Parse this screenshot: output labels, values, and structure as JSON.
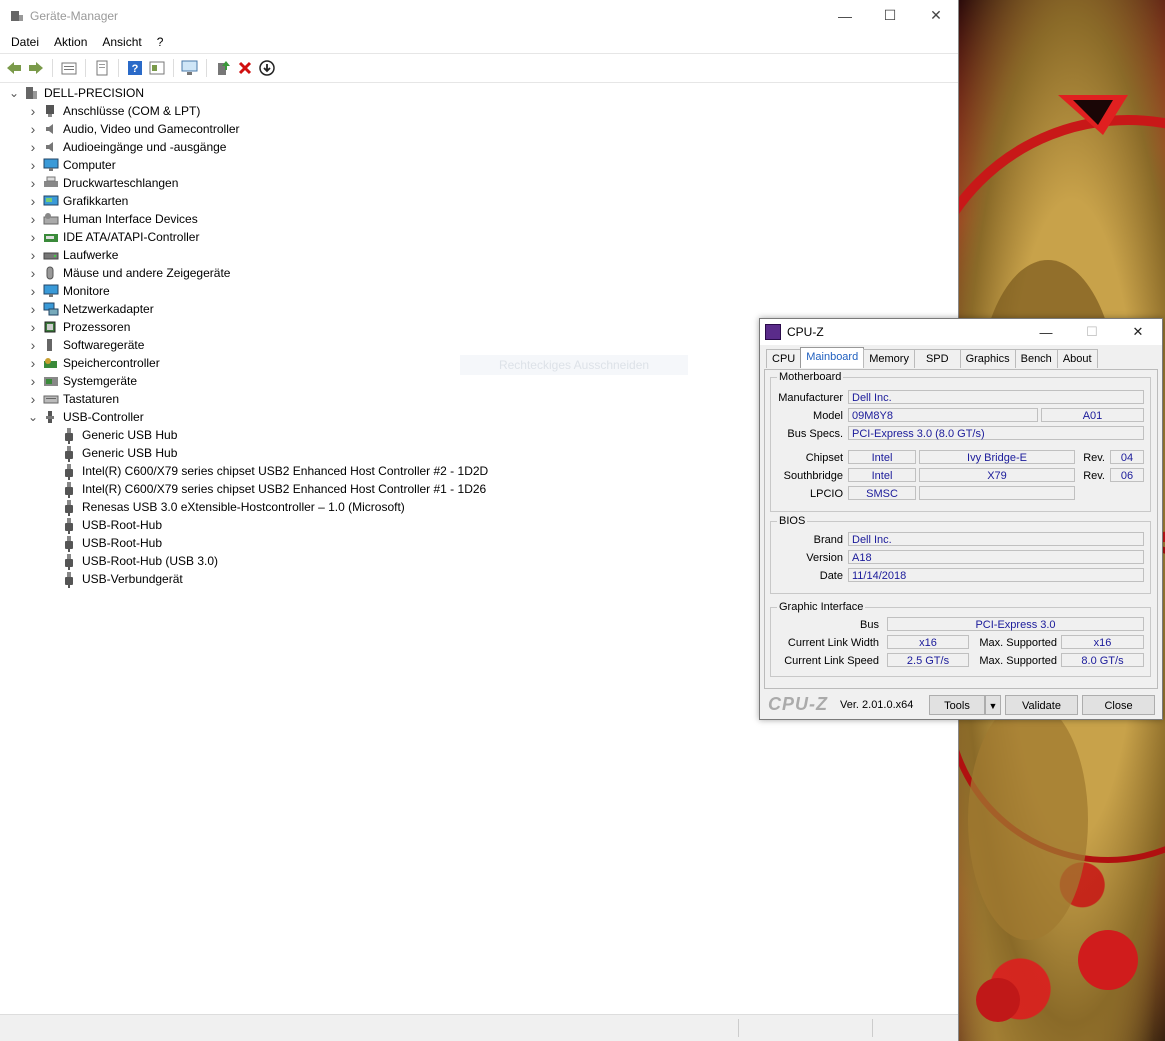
{
  "device_manager": {
    "title": "Geräte-Manager",
    "menu": [
      "Datei",
      "Aktion",
      "Ansicht",
      "?"
    ],
    "root": "DELL-PRECISION",
    "categories": [
      {
        "label": "Anschlüsse (COM & LPT)",
        "icon": "port-icon"
      },
      {
        "label": "Audio, Video und Gamecontroller",
        "icon": "speaker-icon"
      },
      {
        "label": "Audioeingänge und -ausgänge",
        "icon": "speaker-icon"
      },
      {
        "label": "Computer",
        "icon": "monitor-icon"
      },
      {
        "label": "Druckwarteschlangen",
        "icon": "printer-icon"
      },
      {
        "label": "Grafikkarten",
        "icon": "display-adapter-icon"
      },
      {
        "label": "Human Interface Devices",
        "icon": "hid-icon"
      },
      {
        "label": "IDE ATA/ATAPI-Controller",
        "icon": "ide-controller-icon"
      },
      {
        "label": "Laufwerke",
        "icon": "disk-drive-icon"
      },
      {
        "label": "Mäuse und andere Zeigegeräte",
        "icon": "mouse-icon"
      },
      {
        "label": "Monitore",
        "icon": "monitor-icon"
      },
      {
        "label": "Netzwerkadapter",
        "icon": "network-adapter-icon"
      },
      {
        "label": "Prozessoren",
        "icon": "processor-icon"
      },
      {
        "label": "Softwaregeräte",
        "icon": "software-device-icon"
      },
      {
        "label": "Speichercontroller",
        "icon": "storage-controller-icon"
      },
      {
        "label": "Systemgeräte",
        "icon": "system-device-icon"
      },
      {
        "label": "Tastaturen",
        "icon": "keyboard-icon"
      }
    ],
    "usb_category": "USB-Controller",
    "usb_devices": [
      "Generic USB Hub",
      "Generic USB Hub",
      "Intel(R) C600/X79 series chipset USB2 Enhanced Host Controller #2 - 1D2D",
      "Intel(R) C600/X79 series chipset USB2 Enhanced Host Controller #1 - 1D26",
      "Renesas USB 3.0 eXtensible-Hostcontroller – 1.0 (Microsoft)",
      "USB-Root-Hub",
      "USB-Root-Hub",
      "USB-Root-Hub (USB 3.0)",
      "USB-Verbundgerät"
    ],
    "ghost_tooltip": "Rechteckiges Ausschneiden"
  },
  "cpuz": {
    "title": "CPU-Z",
    "tabs": [
      "CPU",
      "Mainboard",
      "Memory",
      "SPD",
      "Graphics",
      "Bench",
      "About"
    ],
    "active_tab": "Mainboard",
    "motherboard": {
      "group": "Motherboard",
      "manufacturer_label": "Manufacturer",
      "manufacturer": "Dell Inc.",
      "model_label": "Model",
      "model": "09M8Y8",
      "model_rev": "A01",
      "busspecs_label": "Bus Specs.",
      "busspecs": "PCI-Express 3.0 (8.0 GT/s)",
      "chipset_label": "Chipset",
      "chipset_vendor": "Intel",
      "chipset_name": "Ivy Bridge-E",
      "chipset_rev_label": "Rev.",
      "chipset_rev": "04",
      "southbridge_label": "Southbridge",
      "southbridge_vendor": "Intel",
      "southbridge_name": "X79",
      "southbridge_rev_label": "Rev.",
      "southbridge_rev": "06",
      "lpcio_label": "LPCIO",
      "lpcio": "SMSC"
    },
    "bios": {
      "group": "BIOS",
      "brand_label": "Brand",
      "brand": "Dell Inc.",
      "version_label": "Version",
      "version": "A18",
      "date_label": "Date",
      "date": "11/14/2018"
    },
    "graphic": {
      "group": "Graphic Interface",
      "bus_label": "Bus",
      "bus": "PCI-Express 3.0",
      "width_label": "Current Link Width",
      "width": "x16",
      "width_max_label": "Max. Supported",
      "width_max": "x16",
      "speed_label": "Current Link Speed",
      "speed": "2.5 GT/s",
      "speed_max_label": "Max. Supported",
      "speed_max": "8.0 GT/s"
    },
    "footer": {
      "logo": "CPU-Z",
      "version": "Ver. 2.01.0.x64",
      "tools": "Tools",
      "validate": "Validate",
      "close": "Close"
    }
  }
}
